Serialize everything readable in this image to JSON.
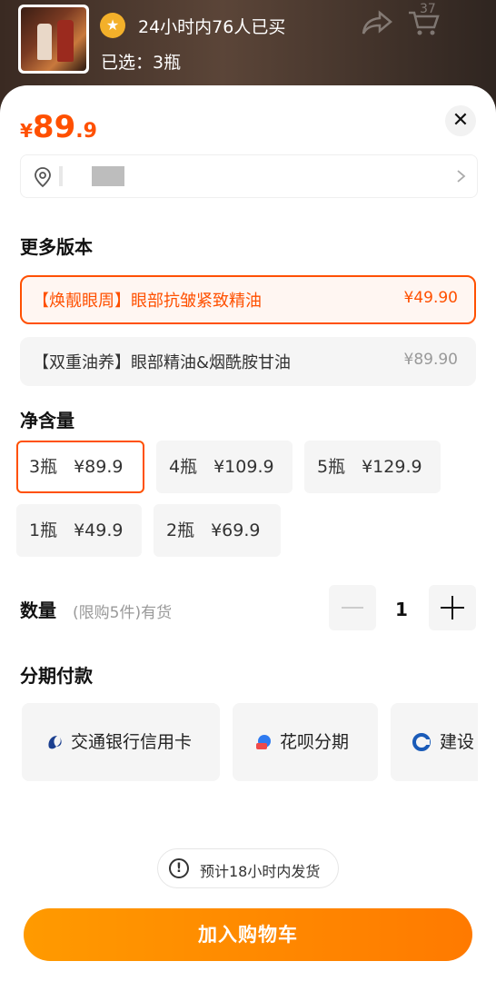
{
  "header": {
    "buy_badge_icon": "bag-icon",
    "buy_text": "24小时内76人已买",
    "selected_text": "已选：3瓶",
    "cart_count": "37",
    "share_icon": "share-icon",
    "cart_icon": "cart-icon"
  },
  "price": {
    "currency": "¥",
    "integer": "89",
    "decimal": ".9",
    "color": "#ff5000"
  },
  "close_icon": "close-icon",
  "address": {
    "location_icon": "location-pin-icon",
    "chevron_icon": "chevron-right-icon"
  },
  "versions": {
    "title": "更多版本",
    "items": [
      {
        "label": "【焕靓眼周】眼部抗皱紧致精油",
        "price": "¥49.90",
        "selected": true
      },
      {
        "label": "【双重油养】眼部精油&烟酰胺甘油",
        "price": "¥89.90",
        "selected": false
      }
    ]
  },
  "net_content": {
    "title": "净含量",
    "options": [
      {
        "qty": "3瓶",
        "price": "¥89.9",
        "selected": true
      },
      {
        "qty": "4瓶",
        "price": "¥109.9",
        "selected": false
      },
      {
        "qty": "5瓶",
        "price": "¥129.9",
        "selected": false
      },
      {
        "qty": "1瓶",
        "price": "¥49.9",
        "selected": false
      },
      {
        "qty": "2瓶",
        "price": "¥69.9",
        "selected": false
      }
    ]
  },
  "quantity": {
    "label": "数量",
    "hint": "(限购5件)有货",
    "value": "1"
  },
  "installment": {
    "title": "分期付款",
    "options": [
      {
        "label": "交通银行信用卡",
        "icon": "bocom-bank-icon"
      },
      {
        "label": "花呗分期",
        "icon": "huabei-icon"
      },
      {
        "label": "建设",
        "icon": "ccb-bank-icon"
      }
    ]
  },
  "shipping": {
    "icon": "alert-circle-icon",
    "text": "预计18小时内发货"
  },
  "add_to_cart": {
    "label": "加入购物车",
    "color": "#ff8a00"
  }
}
